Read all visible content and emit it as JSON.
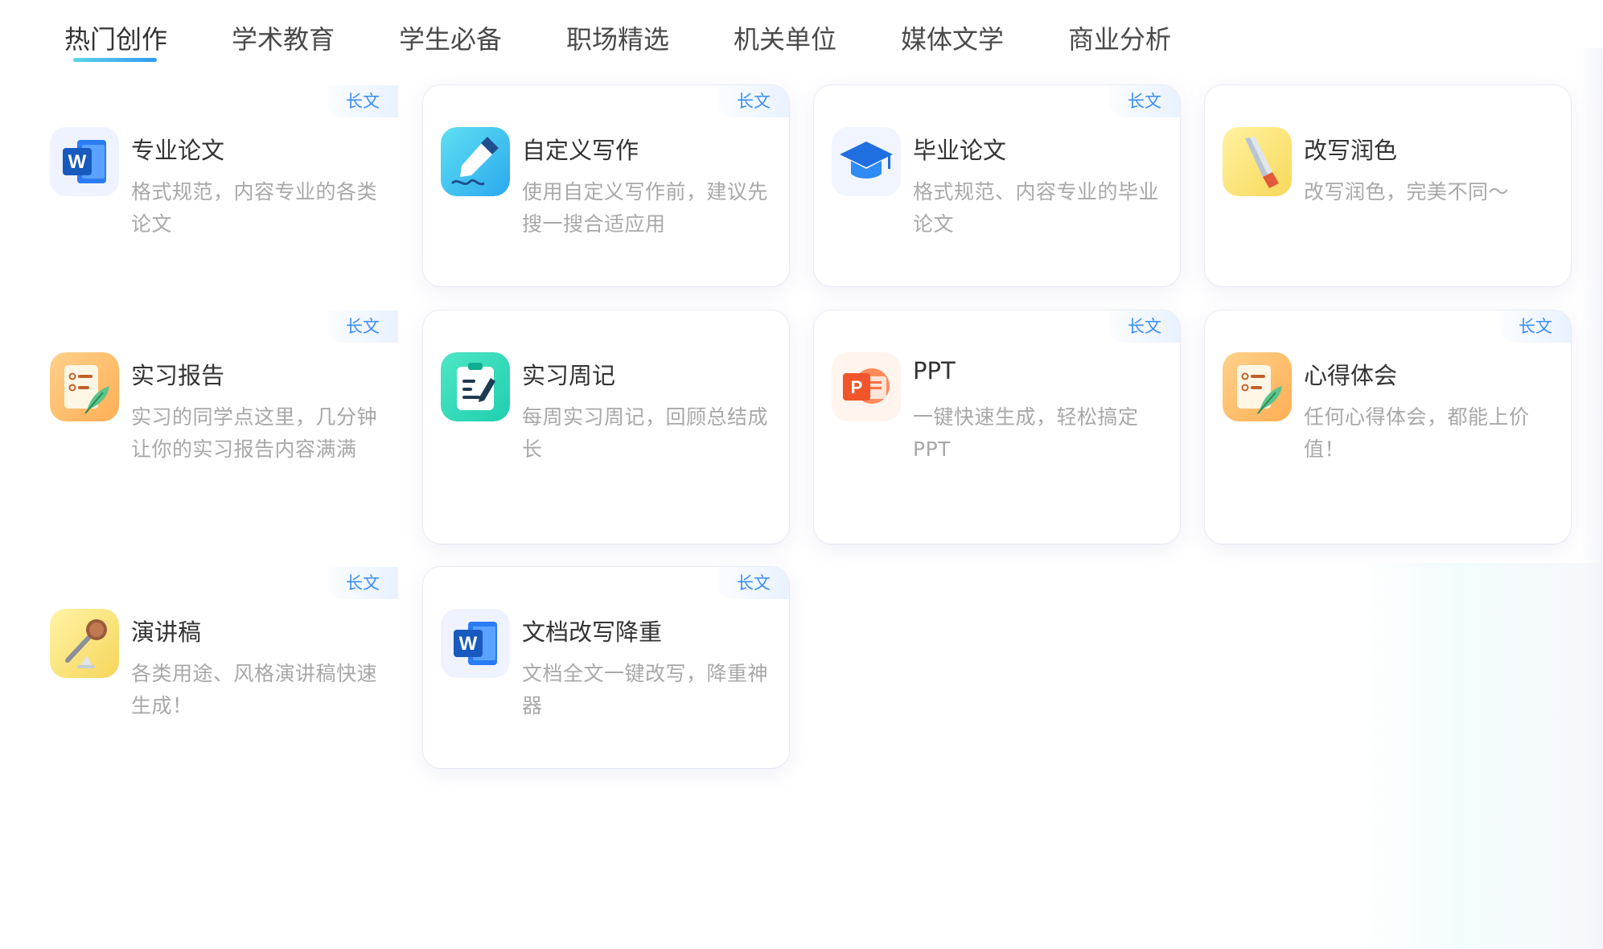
{
  "tabs": [
    {
      "label": "热门创作"
    },
    {
      "label": "学术教育"
    },
    {
      "label": "学生必备"
    },
    {
      "label": "职场精选"
    },
    {
      "label": "机关单位"
    },
    {
      "label": "媒体文学"
    },
    {
      "label": "商业分析"
    }
  ],
  "active_tab_index": 0,
  "accent_gradient": [
    "#5ad3e6",
    "#2f9bf5"
  ],
  "cards": [
    {
      "title": "专业论文",
      "desc": "格式规范，内容专业的各类论文",
      "badge": "长文",
      "icon": "word-doc-icon"
    },
    {
      "title": "自定义写作",
      "desc": "使用自定义写作前，建议先搜一搜合适应用",
      "badge": "长文",
      "icon": "pen-writing-icon"
    },
    {
      "title": "毕业论文",
      "desc": "格式规范、内容专业的毕业论文",
      "badge": "长文",
      "icon": "graduation-cap-icon"
    },
    {
      "title": "改写润色",
      "desc": "改写润色，完美不同～",
      "badge": "",
      "icon": "brush-pen-icon"
    },
    {
      "title": "实习报告",
      "desc": "实习的同学点这里，几分钟让你的实习报告内容满满",
      "badge": "长文",
      "icon": "report-quill-icon"
    },
    {
      "title": "实习周记",
      "desc": "每周实习周记，回顾总结成长",
      "badge": "",
      "icon": "clipboard-pen-icon"
    },
    {
      "title": "PPT",
      "desc": "一键快速生成，轻松搞定PPT",
      "badge": "长文",
      "icon": "powerpoint-icon"
    },
    {
      "title": "心得体会",
      "desc": "任何心得体会，都能上价值！",
      "badge": "长文",
      "icon": "report-quill-icon"
    },
    {
      "title": "演讲稿",
      "desc": "各类用途、风格演讲稿快速生成！",
      "badge": "长文",
      "icon": "microphone-icon"
    },
    {
      "title": "文档改写降重",
      "desc": "文档全文一键改写，降重神器",
      "badge": "长文",
      "icon": "word-doc-icon"
    }
  ]
}
